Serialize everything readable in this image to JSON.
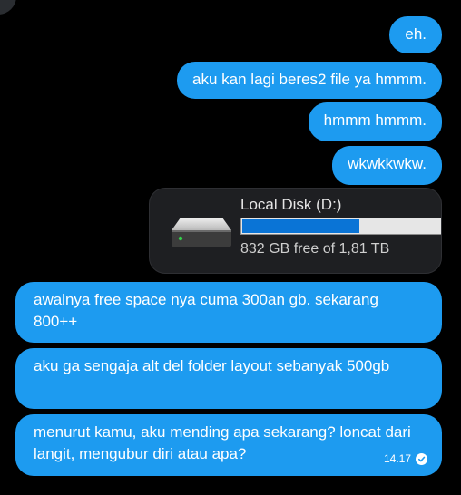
{
  "messages": [
    {
      "text": "eh."
    },
    {
      "text": "aku kan lagi beres2 file ya hmmm."
    },
    {
      "text": "hmmm hmmm."
    },
    {
      "text": "wkwkkwkw."
    },
    {
      "text": "awalnya free space nya cuma 300an gb. sekarang 800++"
    },
    {
      "text": "aku ga sengaja alt del folder layout sebanyak 500gb"
    },
    {
      "text": "menurut kamu, aku mending apa sekarang? loncat dari langit, mengubur diri atau apa?",
      "time": "14.17"
    }
  ],
  "attachment": {
    "drive_name": "Local Disk (D:)",
    "free_text": "832 GB free of 1,81 TB",
    "used_fraction": 0.54,
    "icon": "hard-drive-icon"
  },
  "colors": {
    "background": "#000000",
    "bubble": "#1d9bf0",
    "progress": "#0a74d6"
  }
}
